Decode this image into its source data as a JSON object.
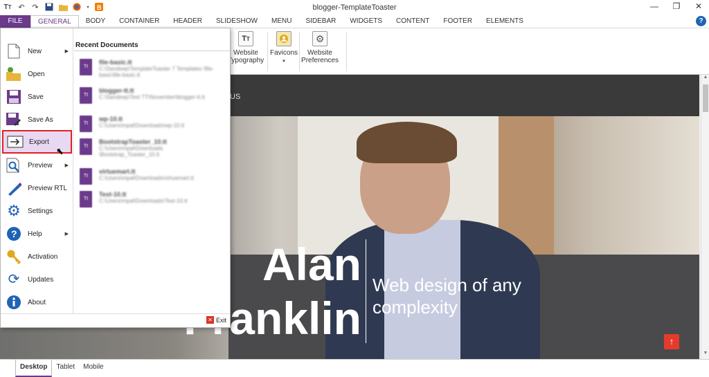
{
  "window": {
    "title": "blogger-TemplateToaster"
  },
  "ribbon_tabs": [
    "FILE",
    "GENERAL",
    "BODY",
    "CONTAINER",
    "HEADER",
    "SLIDESHOW",
    "MENU",
    "SIDEBAR",
    "WIDGETS",
    "CONTENT",
    "FOOTER",
    "ELEMENTS"
  ],
  "ribbon_tab_active": "GENERAL",
  "ribbon": {
    "website_typography": "Website Typography",
    "favicons": "Favicons",
    "website_preferences": "Website Preferences"
  },
  "file_menu": {
    "items": [
      {
        "label": "New",
        "icon": "new-document-icon",
        "submenu": true
      },
      {
        "label": "Open",
        "icon": "open-folder-icon",
        "submenu": false
      },
      {
        "label": "Save",
        "icon": "save-icon",
        "submenu": false
      },
      {
        "label": "Save As",
        "icon": "save-as-icon",
        "submenu": false
      },
      {
        "label": "Export",
        "icon": "export-icon",
        "submenu": false,
        "selected": true
      },
      {
        "label": "Preview",
        "icon": "preview-icon",
        "submenu": true
      },
      {
        "label": "Preview RTL",
        "icon": "preview-rtl-icon",
        "submenu": false
      },
      {
        "label": "Settings",
        "icon": "settings-icon",
        "submenu": false
      },
      {
        "label": "Help",
        "icon": "help-icon",
        "submenu": true
      },
      {
        "label": "Activation",
        "icon": "key-icon",
        "submenu": false
      },
      {
        "label": "Updates",
        "icon": "updates-icon",
        "submenu": false
      },
      {
        "label": "About",
        "icon": "info-icon",
        "submenu": false
      }
    ],
    "recent_title": "Recent Documents",
    "recent_documents": [
      {
        "name": "file-basic.tt",
        "path": "C:\\Sandeep\\TemplateToaster 7 Templates \\file-basic\\file-basic.tt"
      },
      {
        "name": "blogger-tt.tt",
        "path": "C:\\Sandeep\\Test TT\\November\\blogger-tt.tt"
      },
      {
        "name": "wp-10.tt",
        "path": "C:\\Users\\mpal\\Downloads\\wp-10.tt"
      },
      {
        "name": "BootstrapToaster_10.tt",
        "path": "C:\\Users\\mpal\\Downloads \\Bootstrap_Toaster_10.tt"
      },
      {
        "name": "virtuemart.tt",
        "path": "C:\\Users\\mpal\\Downloads\\virtuemart.tt"
      },
      {
        "name": "Test-10.tt",
        "path": "C:\\Users\\mpal\\Downloads\\Test-10.tt"
      }
    ],
    "exit_label": "Exit"
  },
  "preview": {
    "nav_text": "US",
    "hero_title": "Alan Franklin",
    "hero_subtitle": "Web design of any complexity",
    "scroll_top_icon": "arrow-up-icon"
  },
  "device_tabs": [
    "Desktop",
    "Tablet",
    "Mobile"
  ],
  "device_tab_active": "Desktop",
  "colors": {
    "brand": "#6b3a8c",
    "highlight": "#e21f1f",
    "scroll_top": "#e53b2c"
  }
}
